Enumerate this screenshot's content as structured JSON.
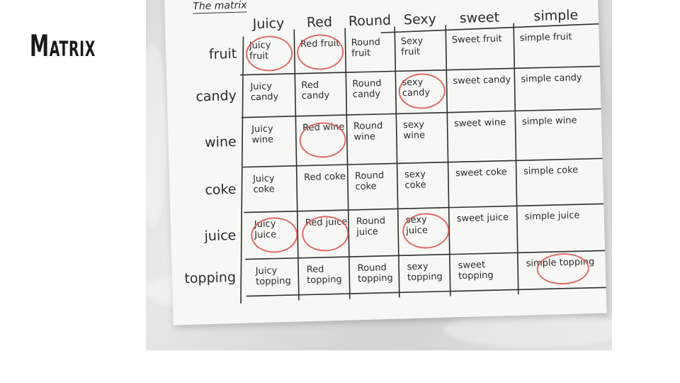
{
  "slide": {
    "title": "Matrix"
  },
  "sheet": {
    "title": "The matrix",
    "columns": [
      "Juicy",
      "Red",
      "Round",
      "Sexy",
      "sweet",
      "simple"
    ],
    "rows": [
      {
        "label": "fruit",
        "cells": [
          "Juicy fruit",
          "Red fruit",
          "Round fruit",
          "Sexy fruit",
          "Sweet fruit",
          "simple fruit"
        ],
        "circled": [
          true,
          true,
          false,
          false,
          false,
          false
        ]
      },
      {
        "label": "candy",
        "cells": [
          "Juicy candy",
          "Red candy",
          "Round candy",
          "sexy candy",
          "sweet candy",
          "simple candy"
        ],
        "circled": [
          false,
          false,
          false,
          true,
          false,
          false
        ]
      },
      {
        "label": "wine",
        "cells": [
          "Juicy wine",
          "Red wine",
          "Round wine",
          "sexy wine",
          "sweet wine",
          "simple wine"
        ],
        "circled": [
          false,
          true,
          false,
          false,
          false,
          false
        ]
      },
      {
        "label": "coke",
        "cells": [
          "Juicy coke",
          "Red coke",
          "Round coke",
          "sexy coke",
          "sweet coke",
          "simple coke"
        ],
        "circled": [
          false,
          false,
          false,
          false,
          false,
          false
        ]
      },
      {
        "label": "juice",
        "cells": [
          "Juicy Juice",
          "Red juice",
          "Round juice",
          "sexy juice",
          "sweet juice",
          "simple juice"
        ],
        "circled": [
          true,
          true,
          false,
          true,
          false,
          false
        ]
      },
      {
        "label": "topping",
        "cells": [
          "Juicy topping",
          "Red topping",
          "Round topping",
          "sexy topping",
          "sweet topping",
          "simple topping"
        ],
        "circled": [
          false,
          false,
          false,
          false,
          false,
          true
        ]
      }
    ]
  }
}
